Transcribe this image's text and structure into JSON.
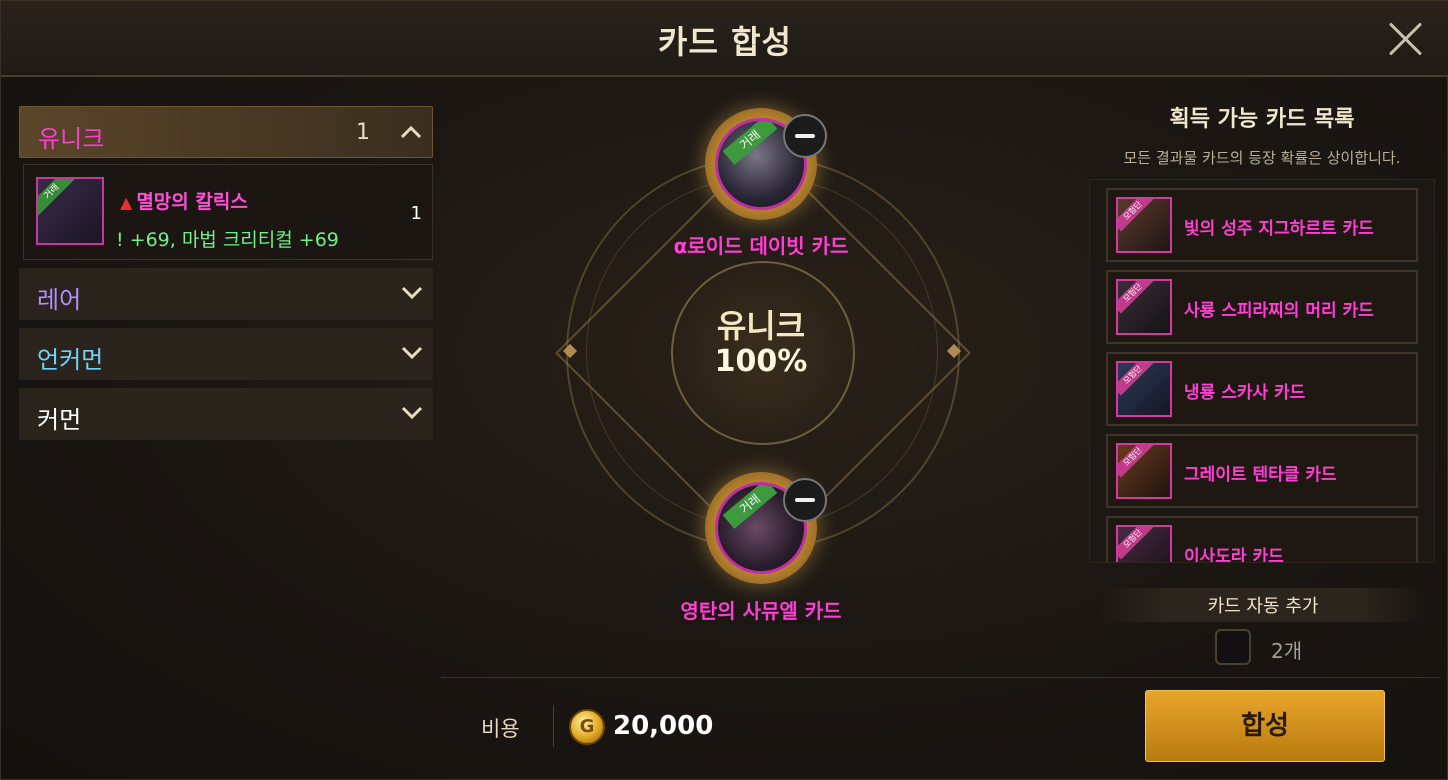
{
  "title": "카드 합성",
  "left": {
    "categories": [
      {
        "label": "유니크",
        "count": "1",
        "color": "#ff3fd3",
        "expanded": true
      },
      {
        "label": "레어",
        "color": "#b48cff",
        "expanded": false
      },
      {
        "label": "언커먼",
        "color": "#6fd3ff",
        "expanded": false
      },
      {
        "label": "커먼",
        "color": "#ffffff",
        "expanded": false
      }
    ],
    "entry": {
      "ribbon": "거래",
      "name": "멸망의 칼릭스",
      "stats": "! +69, 마법 크리티컬 +69",
      "count": "1"
    }
  },
  "center": {
    "top_slot": {
      "ribbon": "거래",
      "label": "α로이드 데이빗 카드"
    },
    "bottom_slot": {
      "ribbon": "거래",
      "label": "영탄의 사뮤엘 카드"
    },
    "rank": "유니크",
    "rate": "100%"
  },
  "right": {
    "header": "획득 가능 카드 목록",
    "subtitle": "모든 결과물 카드의 등장 확률은 상이합니다.",
    "items": [
      {
        "ribbon": "모험단",
        "name": "빛의 성주 지그하르트 카드"
      },
      {
        "ribbon": "모험단",
        "name": "사룡 스피라찌의 머리 카드"
      },
      {
        "ribbon": "모험단",
        "name": "냉룡 스카사 카드"
      },
      {
        "ribbon": "모험단",
        "name": "그레이트 텐타클 카드"
      },
      {
        "ribbon": "모험단",
        "name": "이사도라 카드"
      }
    ],
    "auto_add_label": "카드 자동 추가",
    "auto_add_count": "2개"
  },
  "footer": {
    "cost_label": "비용",
    "gold_glyph": "G",
    "cost_value": "20,000",
    "combine_label": "합성"
  }
}
